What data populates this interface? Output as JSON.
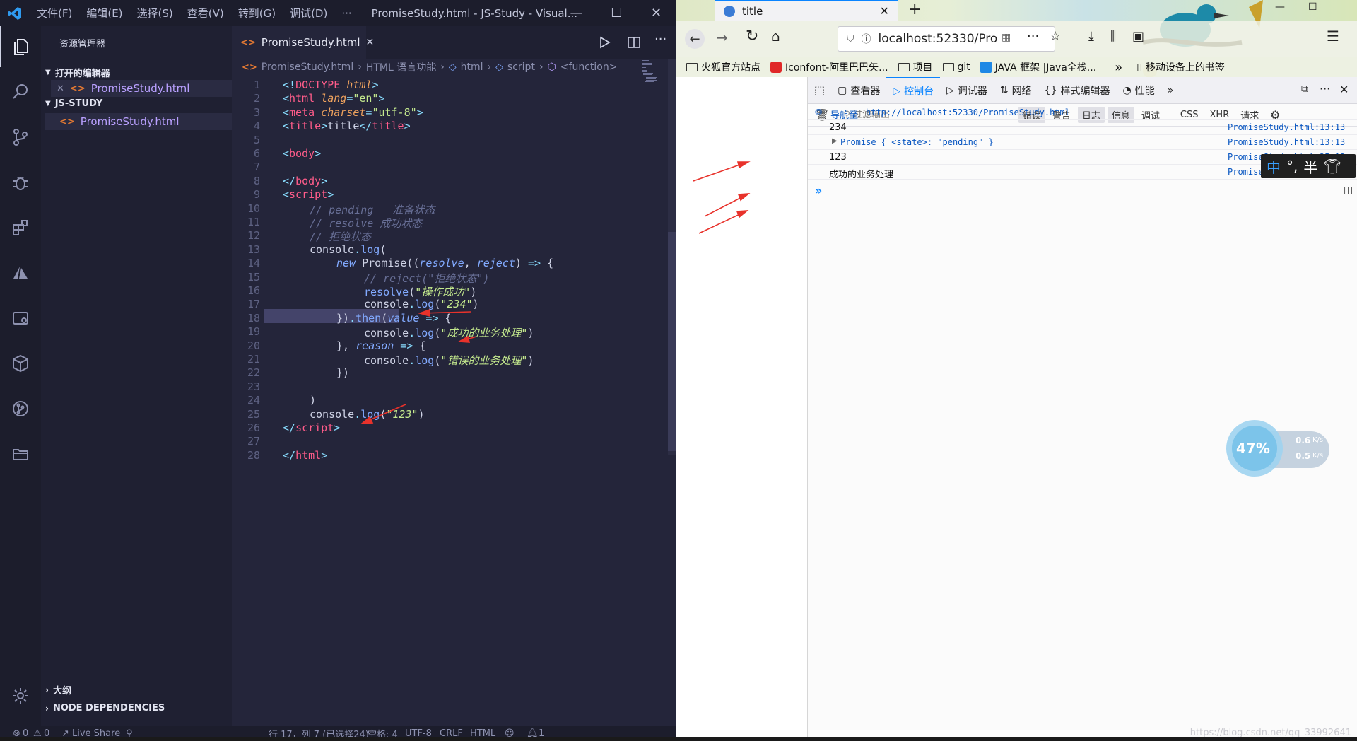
{
  "vscode": {
    "menu": [
      "文件(F)",
      "编辑(E)",
      "选择(S)",
      "查看(V)",
      "转到(G)",
      "调试(D)",
      "···"
    ],
    "window_title": "PromiseStudy.html - JS-Study - Visual...",
    "sidebar": {
      "title": "资源管理器",
      "open_editors_label": "打开的编辑器",
      "open_editor_file": "PromiseStudy.html",
      "workspace_label": "JS-STUDY",
      "workspace_file": "PromiseStudy.html",
      "outline_label": "大纲",
      "node_deps_label": "NODE DEPENDENCIES"
    },
    "tab": {
      "label": "PromiseStudy.html"
    },
    "breadcrumb": [
      "PromiseStudy.html",
      "HTML 语言功能",
      "html",
      "script",
      "<function>"
    ],
    "statusbar": {
      "errors": "0",
      "warnings": "0",
      "live_share": "Live Share",
      "cursor": "行 17，列 7 (已选择24)",
      "indent": "空格: 4",
      "encoding": "UTF-8",
      "eol": "CRLF",
      "language": "HTML",
      "notifications": "1"
    },
    "code_lines": [
      "1",
      "2",
      "3",
      "4",
      "5",
      "6",
      "7",
      "8",
      "9",
      "10",
      "11",
      "12",
      "13",
      "14",
      "15",
      "16",
      "17",
      "18",
      "19",
      "20",
      "21",
      "22",
      "23",
      "24",
      "25",
      "26",
      "27",
      "28"
    ],
    "code": {
      "l1a": "<!",
      "l1b": "DOCTYPE",
      "l1c": " html",
      "l1d": ">",
      "l2a": "<",
      "l2b": "html",
      "l2c": " lang",
      "l2d": "=",
      "l2e": "\"en\"",
      "l2f": ">",
      "l3a": "<",
      "l3b": "meta",
      "l3c": " charset",
      "l3d": "=",
      "l3e": "\"utf-8\"",
      "l3f": ">",
      "l4a": "<",
      "l4b": "title",
      "l4c": ">",
      "l4d": "title",
      "l4e": "</",
      "l4f": "title",
      "l4g": ">",
      "l6a": "<",
      "l6b": "body",
      "l6c": ">",
      "l8a": "</",
      "l8b": "body",
      "l8c": ">",
      "l9a": "<",
      "l9b": "script",
      "l9c": ">",
      "l10": "// pending   准备状态",
      "l11": "// resolve 成功状态",
      "l12": "// 拒绝状态",
      "l13a": "console",
      "l13b": ".",
      "l13c": "log",
      "l13d": "(",
      "l14a": "new",
      "l14b": " Promise",
      "l14c": "((",
      "l14d": "resolve",
      "l14e": ", ",
      "l14f": "reject",
      "l14g": ") ",
      "l14h": "=>",
      "l14i": " {",
      "l15": "// reject(\"拒绝状态\")",
      "l16a": "resolve",
      "l16b": "(",
      "l16c": "\"操作成功\"",
      "l16d": ")",
      "l17a": "console",
      "l17b": ".",
      "l17c": "log",
      "l17d": "(",
      "l17e": "\"234\"",
      "l17f": ")",
      "l18a": "})",
      "l18b": ".",
      "l18c": "then",
      "l18d": "(",
      "l18e": "value",
      "l18f": " =>",
      "l18g": " {",
      "l19a": "console",
      "l19b": ".",
      "l19c": "log",
      "l19d": "(",
      "l19e": "\"成功的业务处理\"",
      "l19f": ")",
      "l20a": "}, ",
      "l20b": "reason",
      "l20c": " =>",
      "l20d": " {",
      "l21a": "console",
      "l21b": ".",
      "l21c": "log",
      "l21d": "(",
      "l21e": "\"错误的业务处理\"",
      "l21f": ")",
      "l22": "})",
      "l24": ")",
      "l25a": "console",
      "l25b": ".",
      "l25c": "log",
      "l25d": "(",
      "l25e": "\"123\"",
      "l25f": ")",
      "l26a": "</",
      "l26b": "script",
      "l26c": ">",
      "l28a": "</",
      "l28b": "html",
      "l28c": ">"
    }
  },
  "browser": {
    "tab_title": "title",
    "url": "localhost:52330/Pro",
    "bookmarks": [
      "火狐官方站点",
      "Iconfont-阿里巴巴矢...",
      "项目",
      "git",
      "JAVA 框架 |Java全栈...",
      "移动设备上的书签"
    ],
    "devtools": {
      "tabs": [
        "查看器",
        "控制台",
        "调试器",
        "网络",
        "样式编辑器",
        "性能"
      ],
      "filter_placeholder": "过滤输出",
      "filters": [
        "错误",
        "警告",
        "日志",
        "信息",
        "调试",
        "CSS",
        "XHR",
        "请求"
      ],
      "nav_label": "导航至",
      "nav_url": "http://localhost:52330/PromiseStudy.html",
      "console": [
        {
          "msg": "234",
          "src": "PromiseStudy.html:13:13"
        },
        {
          "msg": "Promise { <state>: \"pending\" }",
          "src": "PromiseStudy.html:13:13"
        },
        {
          "msg": "123",
          "src": "PromiseStudy.html:25:13"
        },
        {
          "msg": "成功的业务处理",
          "src": "PromiseStudy.html:19:21"
        }
      ]
    },
    "ime": {
      "char": "中",
      "punct": "°,",
      "mode": "半"
    },
    "net": {
      "percent": "47%",
      "up": "0.6",
      "down": "0.5",
      "unit": "K/s"
    },
    "watermark": "https://blog.csdn.net/qq_33992641"
  },
  "colors": {
    "annotation_arrow": "#e8322b",
    "accent": "#0a84ff"
  }
}
